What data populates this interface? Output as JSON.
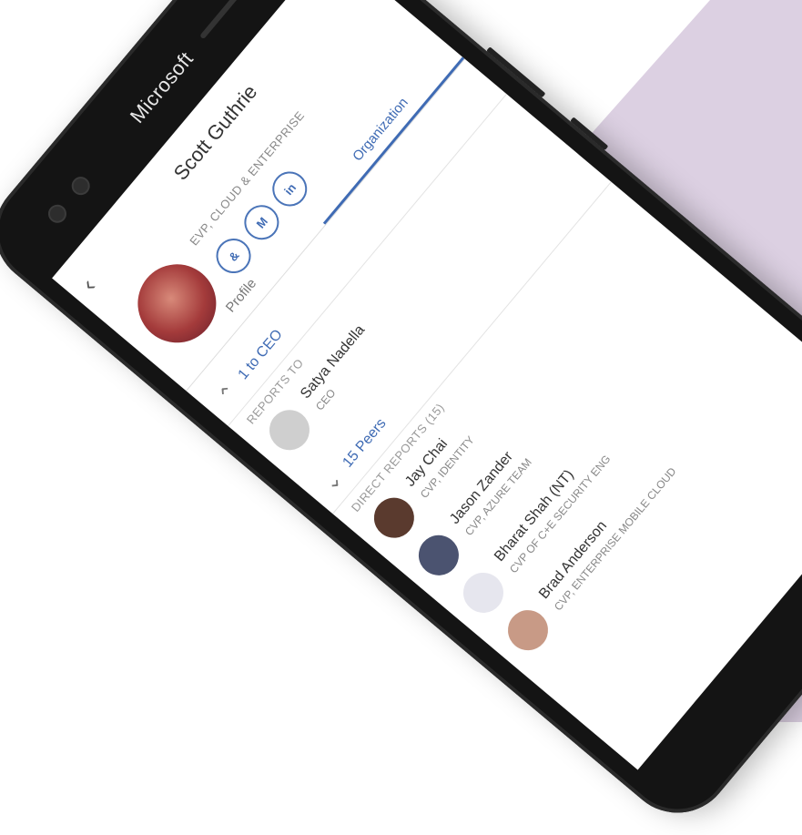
{
  "colors": {
    "background": "#ffffff",
    "accent_shape": "#dcd0e2",
    "phone_body": "#141414",
    "link_blue": "#3f6bb4"
  },
  "device": {
    "brand": "Microsoft"
  },
  "header": {
    "back_icon": "back-chevron-icon",
    "search_icon": "search-icon",
    "title": "Scott Guthrie"
  },
  "profile": {
    "role": "EVP, CLOUD & ENTERPRISE",
    "actions": [
      {
        "icon": "phone-icon",
        "label": "&"
      },
      {
        "icon": "mail-icon",
        "label": "M"
      },
      {
        "icon": "linkedin-icon",
        "label": "in"
      }
    ]
  },
  "tabs": [
    {
      "label": "Profile",
      "active": false
    },
    {
      "label": "Organization",
      "active": true
    }
  ],
  "to_ceo": {
    "label": "1 to CEO"
  },
  "reports_to": {
    "heading": "REPORTS TO",
    "person": {
      "name": "Satya Nadella",
      "title": "CEO"
    }
  },
  "peers": {
    "label": "15 Peers"
  },
  "direct_reports": {
    "heading": "DIRECT REPORTS (15)",
    "people": [
      {
        "name": "Jay Chai",
        "title": "CVP, IDENTITY"
      },
      {
        "name": "Jason Zander",
        "title": "CVP, AZURE TEAM"
      },
      {
        "name": "Bharat Shah (NT)",
        "title": "CVP OF C+E SECURITY ENG"
      },
      {
        "name": "Brad Anderson",
        "title": "CVP, ENTERPRISE MOBILE CLOUD"
      }
    ]
  }
}
